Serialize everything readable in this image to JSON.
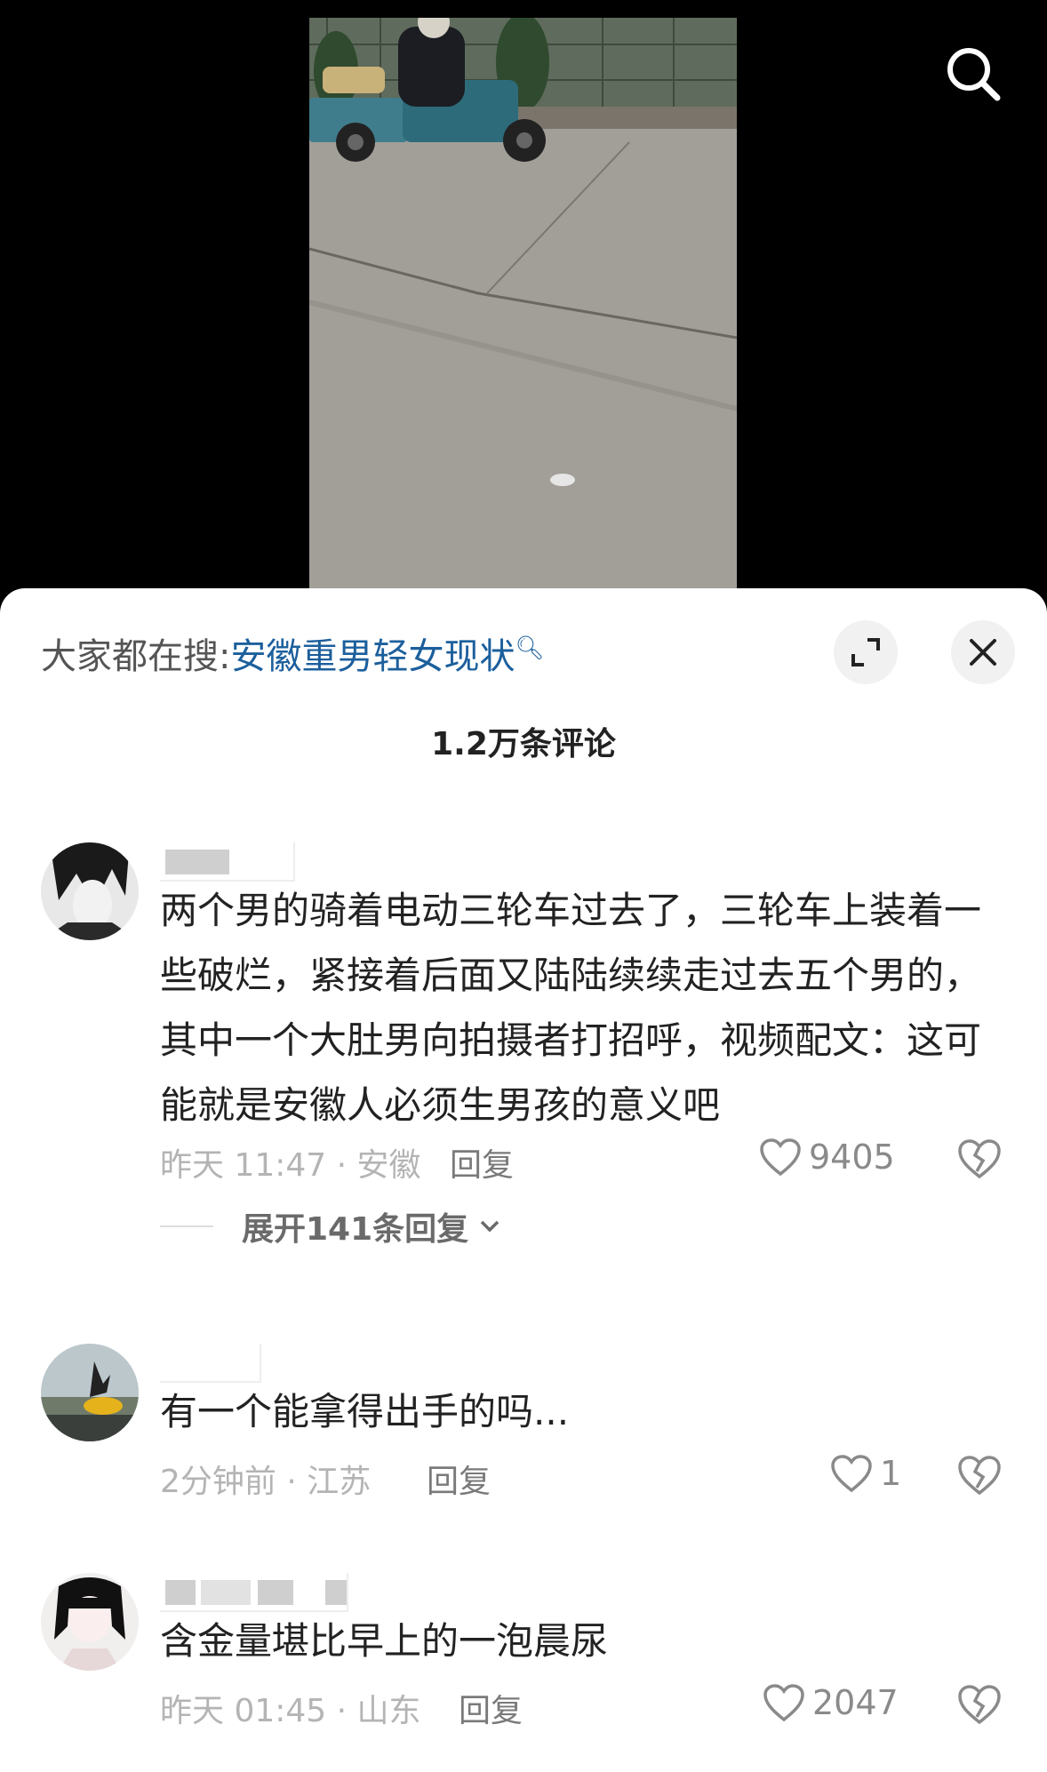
{
  "search_hint": {
    "prefix": "大家都在搜:",
    "keyword": "安徽重男轻女现状"
  },
  "comment_count": "1.2万条评论",
  "comments": [
    {
      "text": "两个男的骑着电动三轮车过去了，三轮车上装着一些破烂，紧接着后面又陆陆续续走过去五个男的，其中一个大肚男向拍摄者打招呼，视频配文：这可能就是安徽人必须生男孩的意义吧",
      "time_location": "昨天 11:47 · 安徽",
      "reply": "回复",
      "likes": "9405",
      "expand_replies": "展开141条回复"
    },
    {
      "text": "有一个能拿得出手的吗...",
      "time_location": "2分钟前 · 江苏",
      "reply": "回复",
      "likes": "1"
    },
    {
      "text": "含金量堪比早上的一泡晨尿",
      "time_location": "昨天 01:45 · 山东",
      "reply": "回复",
      "likes": "2047"
    }
  ],
  "icons": {
    "search": "search-icon",
    "expand": "expand-icon",
    "close": "close-icon",
    "like": "heart-icon",
    "dislike": "broken-heart-icon",
    "chevron": "chevron-down-icon"
  },
  "colors": {
    "keyword": "#1c5f9c",
    "meta": "#b4b4b4"
  }
}
